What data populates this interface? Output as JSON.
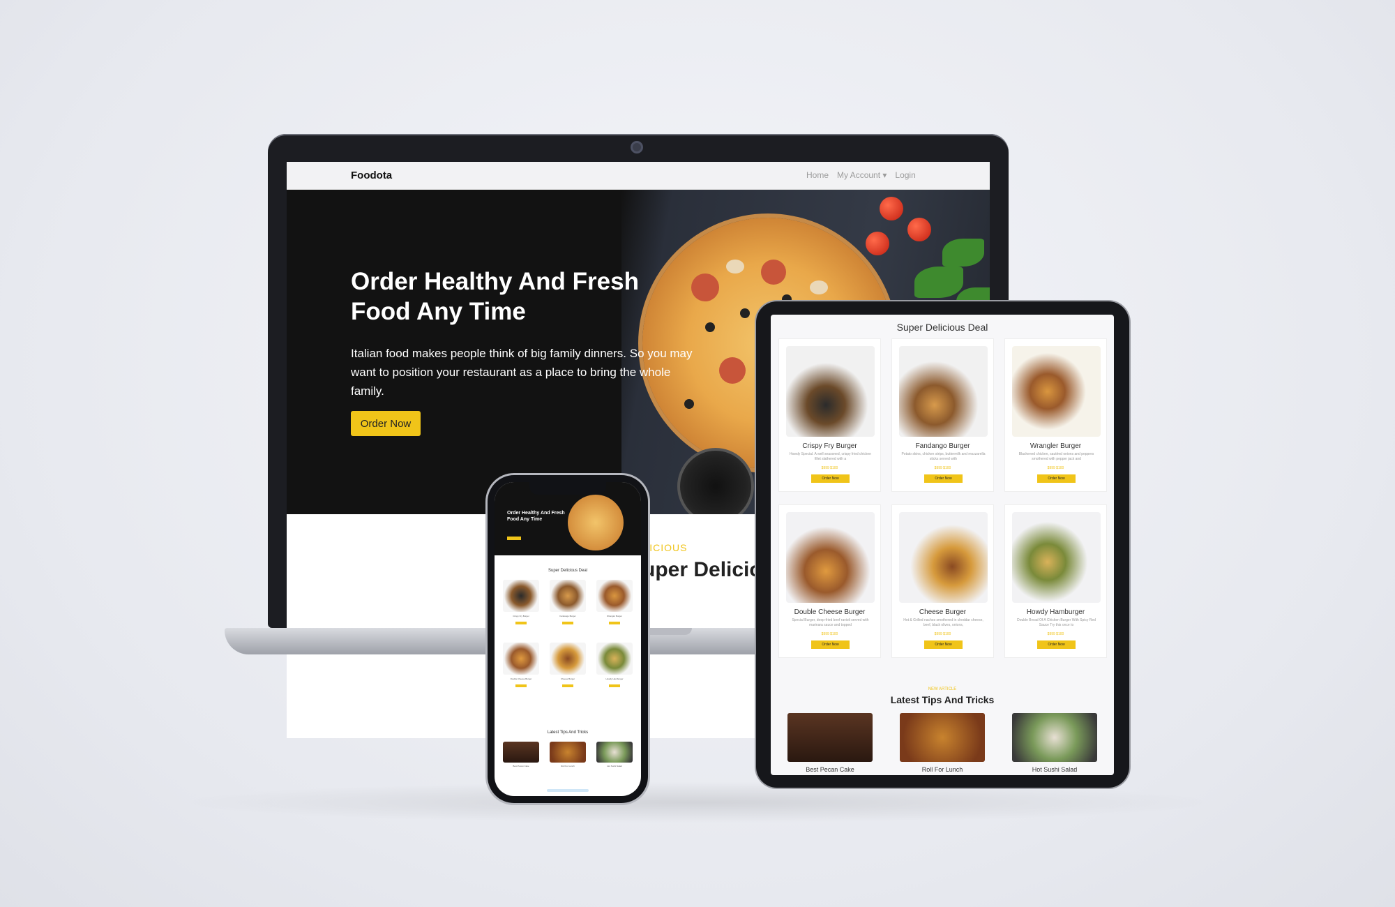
{
  "laptop": {
    "brand": "Foodota",
    "nav": [
      "Home",
      "My Account",
      "Login"
    ],
    "hero_title": "Order Healthy And Fresh Food Any Time",
    "hero_text": "Italian food makes people think of big family dinners. So you may want to position your restaurant as a place to bring the whole family.",
    "hero_button": "Order Now",
    "section_sub": "DELICIOUS",
    "section_title": "Super Delicious Deal"
  },
  "tablet": {
    "section_title": "Super Delicious Deal",
    "cards": [
      {
        "name": "Crispy Fry Burger",
        "desc": "Howdy Special. A well seasoned, crispy fried chicken fillet slathered with a",
        "price": "$999 $100",
        "button": "Order Now"
      },
      {
        "name": "Fandango Burger",
        "desc": "Potato skins, chicken strips, buttermilk and mozzarella sticks served with",
        "price": "$999 $100",
        "button": "Order Now"
      },
      {
        "name": "Wrangler Burger",
        "desc": "Blackened chicken, sautéed onions and peppers smothered with pepper jack and",
        "price": "$999 $100",
        "button": "Order Now"
      },
      {
        "name": "Double Cheese Burger",
        "desc": "Special Burger, deep-fried beef ravioli served with marinara sauce and topped",
        "price": "$999 $100",
        "button": "Order Now"
      },
      {
        "name": "Cheese Burger",
        "desc": "Hot & Grilled nachos smothered in cheddar cheese, beef, black olives, onions,",
        "price": "$999 $100",
        "button": "Order Now"
      },
      {
        "name": "Howdy Hamburger",
        "desc": "Double Bread Of A Chicken Burger With Spicy Red Sauce Try this once to",
        "price": "$999 $100",
        "button": "Order Now"
      }
    ],
    "blog_sub": "NEW ARTICLE",
    "blog_title": "Latest Tips And Tricks",
    "blogs": [
      "Best Pecan Cake",
      "Roll For Lunch",
      "Hot Sushi Salad"
    ]
  },
  "phone": {
    "hero_title": "Order Healthy And Fresh Food Any Time",
    "section_title": "Super Delicious Deal",
    "items": [
      "Crispy Fry Burger",
      "Fandango Burger",
      "Wrangler Burger",
      "Double Cheese Burger",
      "Cheese Burger",
      "Howdy Hamburger"
    ],
    "tips_title": "Latest Tips And Tricks",
    "blogs": [
      "Best Pecan Cake",
      "Roll For Lunch",
      "Hot Sushi Salad"
    ]
  },
  "colors": {
    "accent": "#f0c419",
    "hero_bg": "#121212",
    "device": "#1c1d22"
  }
}
